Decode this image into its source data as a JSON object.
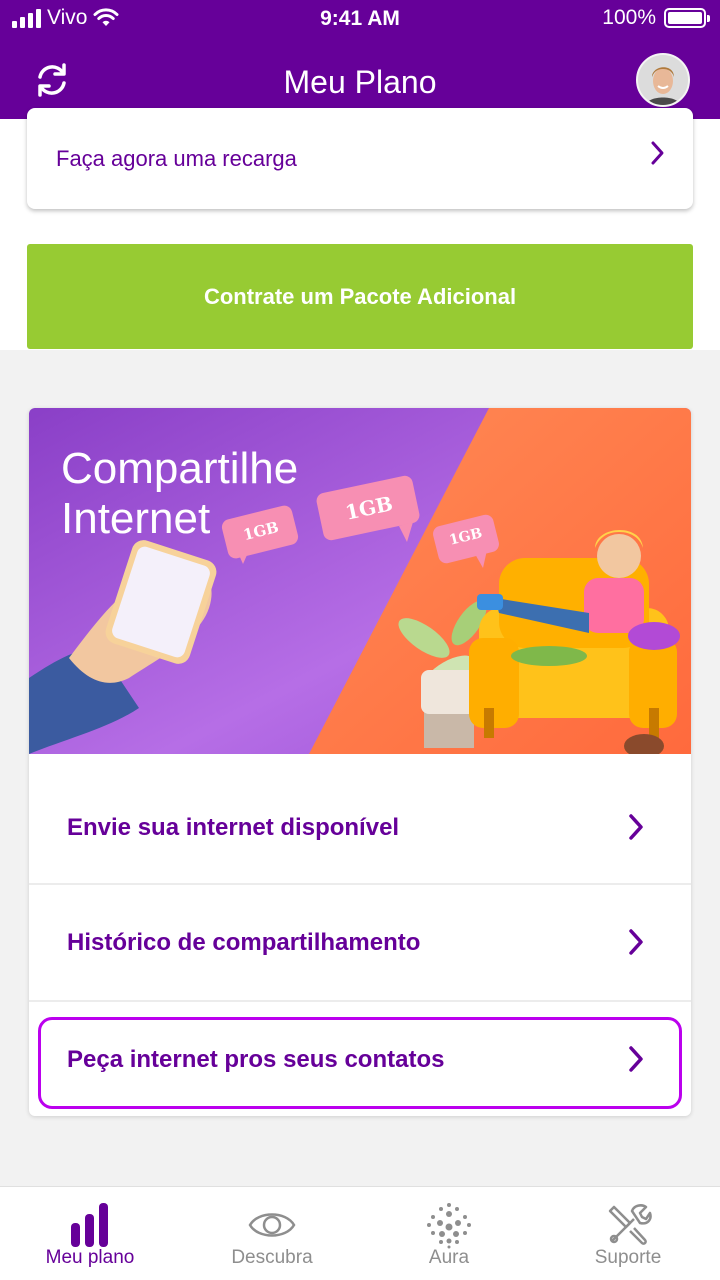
{
  "status_bar": {
    "carrier": "Vivo",
    "time": "9:41 AM",
    "battery": "100%"
  },
  "header": {
    "title": "Meu Plano"
  },
  "recarga": {
    "label": "Faça agora uma recarga"
  },
  "pacote_button": {
    "label": "Contrate um Pacote Adicional"
  },
  "share": {
    "banner_title": "Compartilhe Internet",
    "badges": [
      "1GB",
      "1GB",
      "1GB"
    ],
    "items": [
      {
        "label": "Envie sua internet disponível"
      },
      {
        "label": "Histórico de compartilhamento"
      },
      {
        "label": "Peça internet pros seus contatos"
      }
    ]
  },
  "nav": {
    "items": [
      {
        "label": "Meu plano",
        "icon": "bar-chart-icon",
        "active": true
      },
      {
        "label": "Descubra",
        "icon": "eye-icon",
        "active": false
      },
      {
        "label": "Aura",
        "icon": "dots-sphere-icon",
        "active": false
      },
      {
        "label": "Suporte",
        "icon": "tools-icon",
        "active": false
      }
    ]
  },
  "colors": {
    "brand": "#660099",
    "green": "#97cb33",
    "highlight": "#bb00ee",
    "orange": "#ff6a3d"
  }
}
